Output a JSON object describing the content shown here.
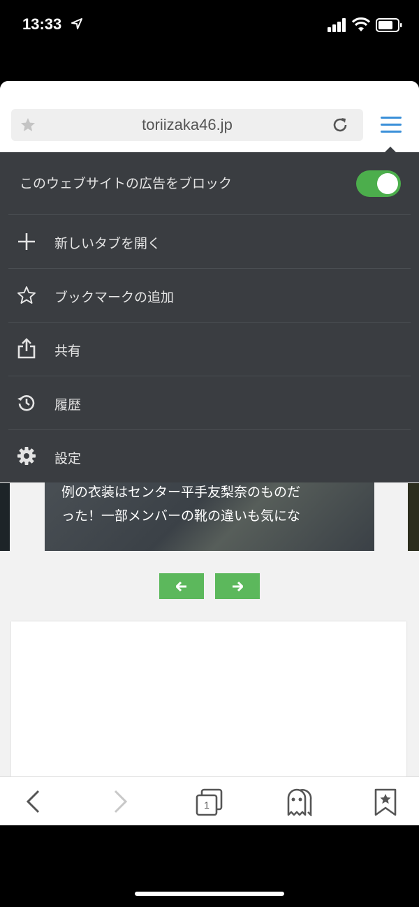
{
  "status_bar": {
    "time": "13:33"
  },
  "browser": {
    "url": "toriizaka46.jp"
  },
  "menu": {
    "adblock_label": "このウェブサイトの広告をブロック",
    "adblock_enabled": true,
    "items": [
      {
        "label": "新しいタブを開く",
        "icon": "plus-icon"
      },
      {
        "label": "ブックマークの追加",
        "icon": "star-outline-icon"
      },
      {
        "label": "共有",
        "icon": "share-icon"
      },
      {
        "label": "履歴",
        "icon": "history-icon"
      },
      {
        "label": "設定",
        "icon": "gear-icon"
      }
    ]
  },
  "content": {
    "caption_line1": "例の衣装はセンター平手友梨奈のものだ",
    "caption_line2": "った！一部メンバーの靴の違いも気にな"
  },
  "toolbar": {
    "tab_count": "1"
  },
  "colors": {
    "accent": "#3a8fd8",
    "toggle_on": "#4cae4c",
    "menu_bg": "#3a3d41",
    "pager_button": "#5cb85c"
  }
}
